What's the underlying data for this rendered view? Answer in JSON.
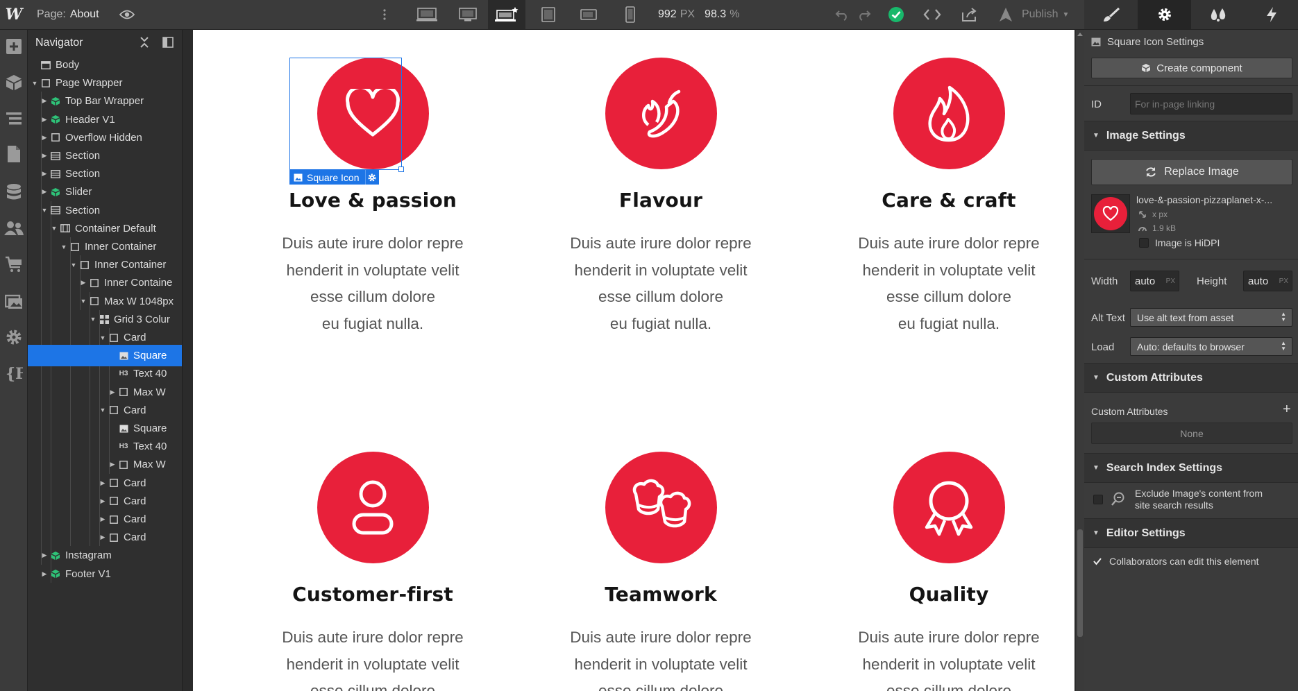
{
  "topbar": {
    "logo": "W",
    "page_label": "Page:",
    "page_name": "About",
    "width_value": "992",
    "width_unit": "PX",
    "zoom": "98.3",
    "zoom_unit": "%",
    "publish_label": "Publish"
  },
  "navigator": {
    "title": "Navigator",
    "items": [
      {
        "label": "Body"
      },
      {
        "label": "Page Wrapper"
      },
      {
        "label": "Top Bar Wrapper"
      },
      {
        "label": "Header V1"
      },
      {
        "label": "Overflow Hidden"
      },
      {
        "label": "Section"
      },
      {
        "label": "Section"
      },
      {
        "label": "Slider"
      },
      {
        "label": "Section"
      },
      {
        "label": "Container Default"
      },
      {
        "label": "Inner Container"
      },
      {
        "label": "Inner Container"
      },
      {
        "label": "Inner Containe"
      },
      {
        "label": "Max W 1048px"
      },
      {
        "label": "Grid 3 Colur"
      },
      {
        "label": "Card"
      },
      {
        "label": "Square"
      },
      {
        "label": "Text 40"
      },
      {
        "label": "Max W"
      },
      {
        "label": "Card"
      },
      {
        "label": "Square"
      },
      {
        "label": "Text 40"
      },
      {
        "label": "Max W"
      },
      {
        "label": "Card"
      },
      {
        "label": "Card"
      },
      {
        "label": "Card"
      },
      {
        "label": "Card"
      },
      {
        "label": "Instagram"
      },
      {
        "label": "Footer V1"
      }
    ]
  },
  "canvas": {
    "selection_badge": "Square Icon",
    "cards": [
      {
        "title": "Love & passion",
        "lines": [
          "Duis aute irure dolor repre",
          "henderit in voluptate velit",
          "esse cillum dolore",
          "eu fugiat nulla."
        ]
      },
      {
        "title": "Flavour",
        "lines": [
          "Duis aute irure dolor repre",
          "henderit in voluptate velit",
          "esse cillum dolore",
          "eu fugiat nulla."
        ]
      },
      {
        "title": "Care & craft",
        "lines": [
          "Duis aute irure dolor repre",
          "henderit in voluptate velit",
          "esse cillum dolore",
          "eu fugiat nulla."
        ]
      },
      {
        "title": "Customer-first",
        "lines": [
          "Duis aute irure dolor repre",
          "henderit in voluptate velit",
          "esse cillum dolore"
        ]
      },
      {
        "title": "Teamwork",
        "lines": [
          "Duis aute irure dolor repre",
          "henderit in voluptate velit",
          "esse cillum dolore"
        ]
      },
      {
        "title": "Quality",
        "lines": [
          "Duis aute irure dolor repre",
          "henderit in voluptate velit",
          "esse cillum dolore"
        ]
      }
    ]
  },
  "settings": {
    "panel_title": "Square Icon Settings",
    "create_component": "Create component",
    "id_label": "ID",
    "id_placeholder": "For in-page linking",
    "image_settings": "Image Settings",
    "replace_image": "Replace Image",
    "file_name": "love-&-passion-pizzaplanet-x-...",
    "file_dims": "x px",
    "file_size": "1.9 kB",
    "hidpi_label": "Image is HiDPI",
    "width_label": "Width",
    "width_value": "auto",
    "height_label": "Height",
    "height_value": "auto",
    "px_unit": "PX",
    "alt_label": "Alt Text",
    "alt_value": "Use alt text from asset",
    "load_label": "Load",
    "load_value": "Auto: defaults to browser",
    "custom_attributes": "Custom Attributes",
    "custom_attributes_label": "Custom Attributes",
    "custom_attributes_value": "None",
    "search_index": "Search Index Settings",
    "exclude_label_1": "Exclude Image's content from",
    "exclude_label_2": "site search results",
    "editor_settings": "Editor Settings",
    "collab_label": "Collaborators can edit this element"
  },
  "colors": {
    "accent": "#e8203a",
    "selection": "#1d75e6",
    "success": "#18b86b"
  }
}
